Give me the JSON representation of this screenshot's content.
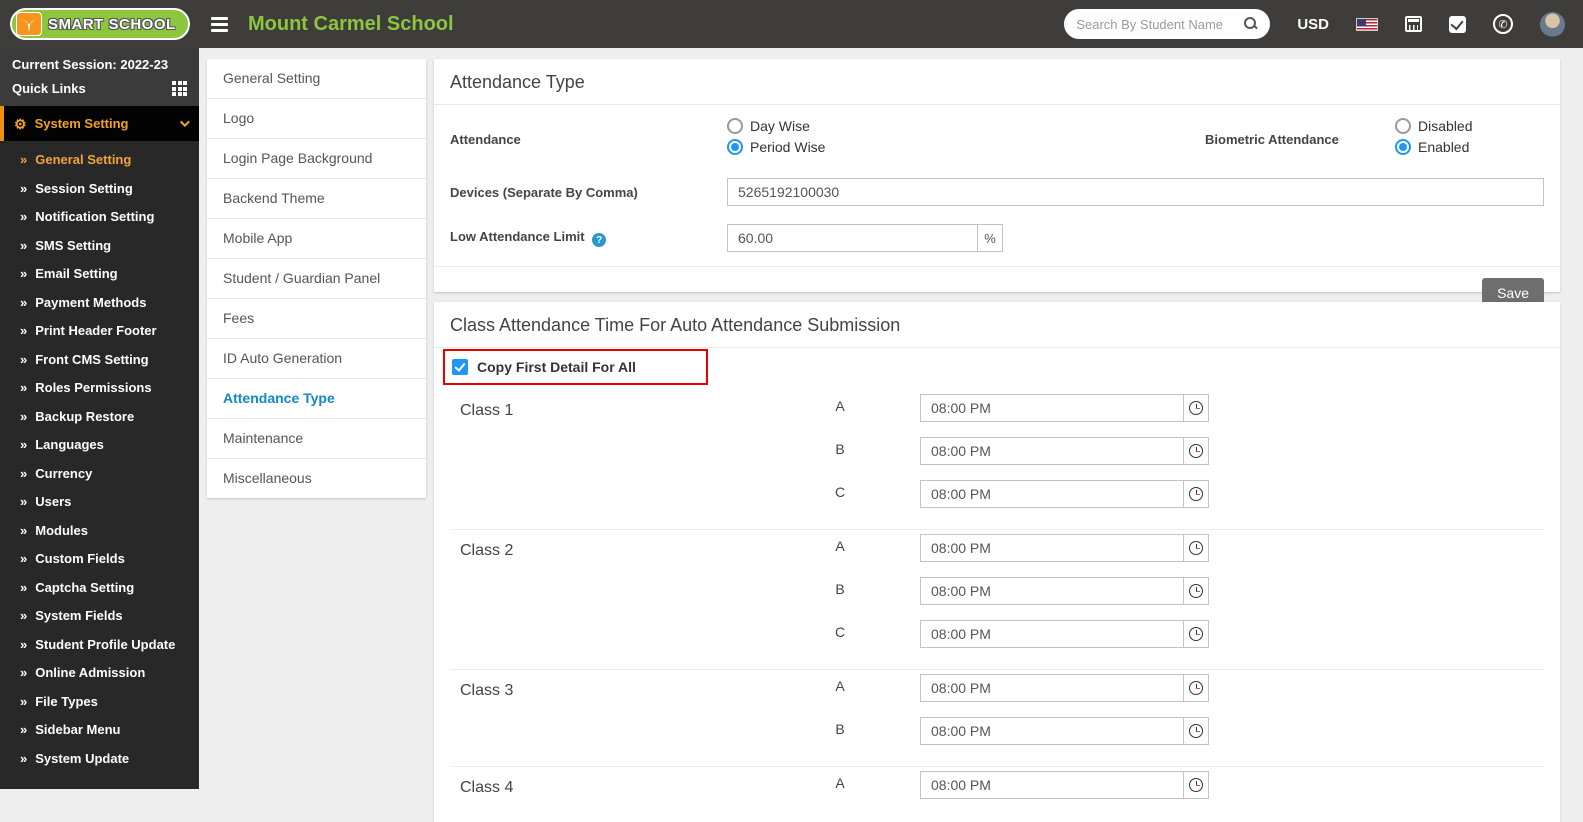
{
  "header": {
    "logo_text": "SMART SCHOOL",
    "school_name": "Mount Carmel School",
    "search_placeholder": "Search By Student Name",
    "currency": "USD"
  },
  "sidebar": {
    "session_label": "Current Session: 2022-23",
    "quick_links_label": "Quick Links",
    "section_label": "System Setting",
    "active_item": "General Setting",
    "items": [
      "General Setting",
      "Session Setting",
      "Notification Setting",
      "SMS Setting",
      "Email Setting",
      "Payment Methods",
      "Print Header Footer",
      "Front CMS Setting",
      "Roles Permissions",
      "Backup Restore",
      "Languages",
      "Currency",
      "Users",
      "Modules",
      "Custom Fields",
      "Captcha Setting",
      "System Fields",
      "Student Profile Update",
      "Online Admission",
      "File Types",
      "Sidebar Menu",
      "System Update"
    ]
  },
  "settings_menu": {
    "active": "Attendance Type",
    "items": [
      "General Setting",
      "Logo",
      "Login Page Background",
      "Backend Theme",
      "Mobile App",
      "Student / Guardian Panel",
      "Fees",
      "ID Auto Generation",
      "Attendance Type",
      "Maintenance",
      "Miscellaneous"
    ]
  },
  "attendance_card": {
    "title": "Attendance Type",
    "attendance_label": "Attendance",
    "attendance_options": [
      {
        "label": "Day Wise",
        "selected": false
      },
      {
        "label": "Period Wise",
        "selected": true
      }
    ],
    "biometric_label": "Biometric Attendance",
    "biometric_options": [
      {
        "label": "Disabled",
        "selected": false
      },
      {
        "label": "Enabled",
        "selected": true
      }
    ],
    "devices_label": "Devices (Separate By Comma)",
    "devices_value": "5265192100030",
    "low_attendance_label": "Low Attendance Limit",
    "help_glyph": "?",
    "low_attendance_value": "60.00",
    "percent_suffix": "%",
    "save_label": "Save"
  },
  "class_card": {
    "title": "Class Attendance Time For Auto Attendance Submission",
    "copy_all_label": "Copy First Detail For All",
    "copy_all_checked": true,
    "classes": [
      {
        "name": "Class 1",
        "sections": [
          {
            "label": "A",
            "time": "08:00 PM"
          },
          {
            "label": "B",
            "time": "08:00 PM"
          },
          {
            "label": "C",
            "time": "08:00 PM"
          }
        ]
      },
      {
        "name": "Class 2",
        "sections": [
          {
            "label": "A",
            "time": "08:00 PM"
          },
          {
            "label": "B",
            "time": "08:00 PM"
          },
          {
            "label": "C",
            "time": "08:00 PM"
          }
        ]
      },
      {
        "name": "Class 3",
        "sections": [
          {
            "label": "A",
            "time": "08:00 PM"
          },
          {
            "label": "B",
            "time": "08:00 PM"
          }
        ]
      },
      {
        "name": "Class 4",
        "sections": [
          {
            "label": "A",
            "time": "08:00 PM"
          }
        ]
      }
    ]
  },
  "colors": {
    "header_bg": "#3e3d3c",
    "brand_green": "#8cc63e",
    "accent_orange": "#f0a325",
    "link_blue": "#1288c5",
    "control_blue": "#2196f3",
    "annotation_red": "#e60000",
    "save_gray": "#6e6e6e"
  }
}
